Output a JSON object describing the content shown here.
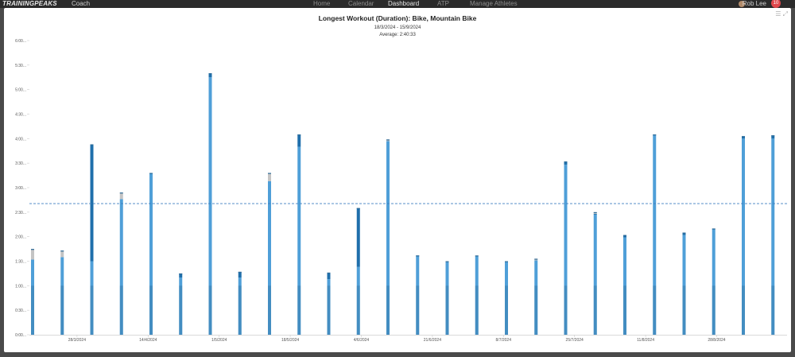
{
  "header": {
    "brand": "TRAININGPEAKS",
    "coach": "Coach",
    "nav": [
      "Home",
      "Calendar",
      "Dashboard",
      "ATP",
      "Manage Athletes"
    ],
    "active_nav": "Dashboard",
    "user_name": "Rob Lee",
    "notification_count": "10"
  },
  "chart_data": {
    "type": "bar",
    "title": "Longest Workout (Duration): Bike, Mountain Bike",
    "subtitle": "18/3/2024 - 15/9/2024",
    "average_label": "Average: 2:40:33",
    "average_minutes": 160.5,
    "xlabel": "",
    "ylabel": "",
    "ylim": [
      0,
      360
    ],
    "y_ticks": [
      0,
      30,
      60,
      90,
      120,
      150,
      180,
      210,
      240,
      270,
      300,
      330,
      360
    ],
    "y_tick_labels": [
      "0:00...",
      "0:30...",
      "1:00...",
      "1:30...",
      "2:00...",
      "2:30...",
      "3:00...",
      "3:30...",
      "4:00...",
      "4:30...",
      "5:00...",
      "5:30...",
      "6:00..."
    ],
    "x_tick_labels": [
      "28/3/2024",
      "14/4/2024",
      "1/5/2024",
      "18/5/2024",
      "4/6/2024",
      "21/6/2024",
      "8/7/2024",
      "25/7/2024",
      "11/8/2024",
      "28/8/2024"
    ],
    "x_tick_bar_index": [
      1.5,
      3.9,
      6.3,
      8.7,
      11.1,
      13.5,
      15.9,
      18.3,
      20.7,
      23.1
    ],
    "series": [
      {
        "values": [
          92,
          95,
          90,
          166,
          198,
          70,
          315,
          70,
          188,
          230,
          68,
          83,
          237,
          96,
          90,
          96,
          90,
          91,
          208,
          147,
          119,
          244,
          122,
          129,
          240,
          240
        ]
      },
      {
        "values": [
          0,
          0,
          143,
          0,
          0,
          5,
          5,
          7,
          0,
          15,
          8,
          72,
          0,
          1,
          0,
          0,
          0,
          0,
          4,
          1,
          3,
          1,
          3,
          0,
          3,
          4
        ]
      },
      {
        "values": [
          13,
          8,
          0,
          8,
          0,
          0,
          0,
          0,
          10,
          0,
          0,
          0,
          2,
          0,
          0,
          1,
          0,
          2,
          0,
          2,
          0,
          0,
          0,
          1,
          0,
          0
        ]
      }
    ],
    "colors": {
      "primary": "#4f9fd8",
      "secondary": "#1f6fab",
      "tertiary": "#c4c4c4",
      "base": "#2f6c99",
      "average_line": "#3d7fc0"
    },
    "grid": false
  }
}
